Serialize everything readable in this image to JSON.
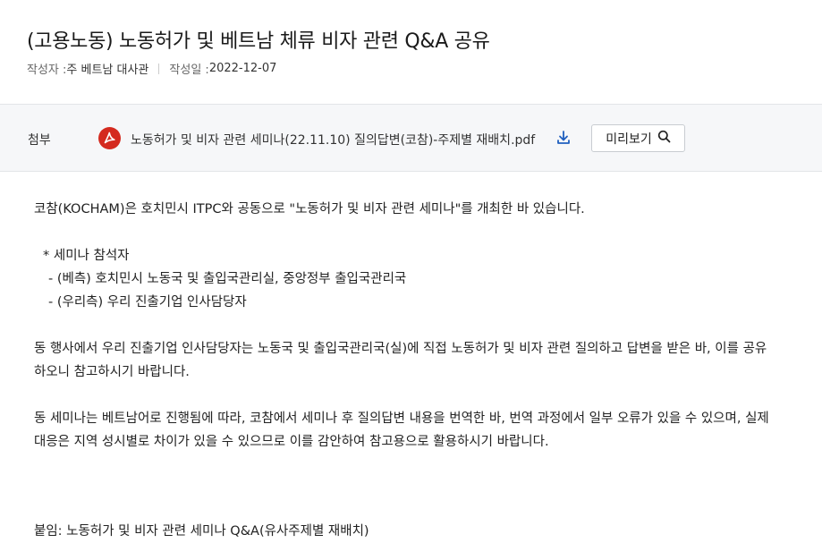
{
  "post": {
    "title": "(고용노동) 노동허가 및 베트남 체류 비자 관련 Q&A 공유",
    "author_label": "작성자 : ",
    "author": "주 베트남 대사관",
    "date_label": "작성일 : ",
    "date": "2022-12-07"
  },
  "attachment": {
    "label": "첨부",
    "file_name": "노동허가 및 비자 관련 세미나(22.11.10) 질의답변(코참)-주제별 재배치.pdf",
    "preview_label": "미리보기",
    "icons": {
      "file": "pdf-icon",
      "download": "download-icon",
      "preview": "search-icon"
    },
    "pdf_color": "#d42a1f",
    "download_color": "#1f5fbf"
  },
  "body": {
    "intro": "코참(KOCHAM)은 호치민시 ITPC와 공동으로 \"노동허가 및 비자 관련 세미나\"를 개최한 바 있습니다.",
    "attendees_heading": "* 세미나 참석자",
    "attendees": [
      "- (베측) 호치민시 노동국 및 출입국관리실, 중앙정부 출입국관리국",
      "- (우리측) 우리 진출기업 인사담당자"
    ],
    "paragraph1_line1": "동 행사에서 우리 진출기업 인사담당자는 노동국 및 출입국관리국(실)에 직접 노동허가 및 비자 관련 질의하고 답변을 받은 바, 이를 공유",
    "paragraph1_line2": "하오니 참고하시기 바랍니다.",
    "paragraph2_line1": "동 세미나는 베트남어로 진행됨에 따라, 코참에서 세미나 후 질의답변 내용을 번역한 바, 번역 과정에서 일부 오류가 있을 수 있으며, 실제",
    "paragraph2_line2": "대응은 지역 성시별로 차이가 있을 수 있으므로 이를 감안하여 참고용으로 활용하시기 바랍니다.",
    "enclosure": "붙임: 노동허가 및 비자 관련 세미나 Q&A(유사주제별 재배치)"
  }
}
